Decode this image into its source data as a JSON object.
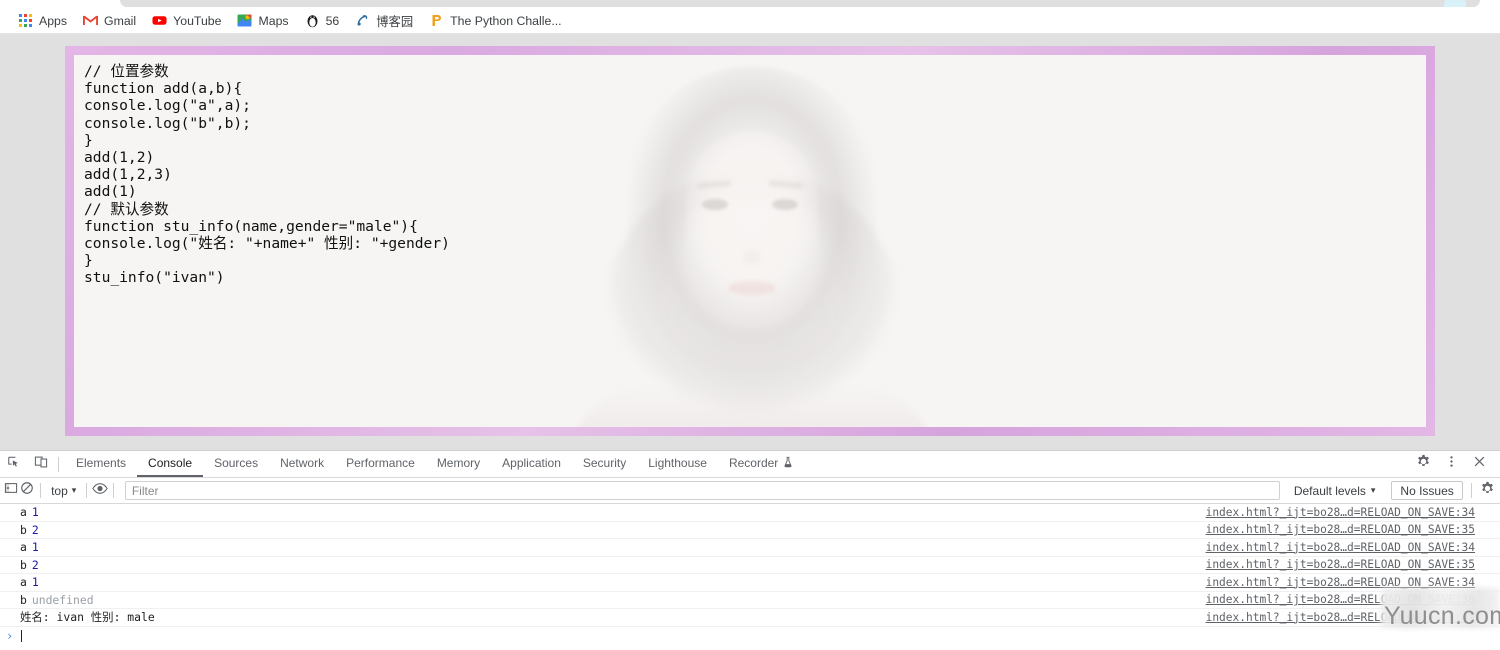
{
  "browser": {
    "bookmarks": [
      {
        "label": "Apps",
        "icon": "apps-grid-icon"
      },
      {
        "label": "Gmail",
        "icon": "gmail-icon"
      },
      {
        "label": "YouTube",
        "icon": "youtube-icon"
      },
      {
        "label": "Maps",
        "icon": "maps-icon"
      },
      {
        "label": "56",
        "icon": "penguin-icon"
      },
      {
        "label": "博客园",
        "icon": "cnblogs-icon"
      },
      {
        "label": "The Python Challe...",
        "icon": "python-challenge-icon"
      }
    ],
    "avatar_icon": "profile-avatar-icon"
  },
  "page": {
    "code": "// 位置参数\nfunction add(a,b){\nconsole.log(\"a\",a);\nconsole.log(\"b\",b);\n}\nadd(1,2)\nadd(1,2,3)\nadd(1)\n// 默认参数\nfunction stu_info(name,gender=\"male\"){\nconsole.log(\"姓名: \"+name+\" 性别: \"+gender)\n}\nstu_info(\"ivan\")",
    "selection_border_color": "#dcaee2",
    "card_background": "#f6f5f4"
  },
  "devtools": {
    "tools": {
      "inspect_icon": "inspect-element-icon",
      "device_toolbar_icon": "device-toolbar-icon",
      "settings_icon": "gear-icon",
      "more_icon": "more-vertical-icon",
      "close_icon": "close-icon"
    },
    "tabs": [
      {
        "label": "Elements",
        "active": false
      },
      {
        "label": "Console",
        "active": true
      },
      {
        "label": "Sources",
        "active": false
      },
      {
        "label": "Network",
        "active": false
      },
      {
        "label": "Performance",
        "active": false
      },
      {
        "label": "Memory",
        "active": false
      },
      {
        "label": "Application",
        "active": false
      },
      {
        "label": "Security",
        "active": false
      },
      {
        "label": "Lighthouse",
        "active": false
      },
      {
        "label": "Recorder",
        "active": false,
        "badge_icon": "experiment-flask-icon"
      }
    ],
    "toolbar": {
      "sidebar_toggle_icon": "console-sidebar-icon",
      "clear_console_icon": "clear-console-icon",
      "context_value": "top",
      "context_caret": "▾",
      "eye_icon": "live-expression-eye-icon",
      "filter_placeholder": "Filter",
      "filter_value": "",
      "level_value": "Default levels",
      "level_caret": "▾",
      "issues_label": "No Issues",
      "console_settings_icon": "gear-icon"
    },
    "console": {
      "accent_number_color": "#1a1aa6",
      "messages": [
        {
          "label": "a",
          "value": "1",
          "value_type": "number",
          "source": "index.html?_ijt=bo28…d=RELOAD_ON_SAVE:34"
        },
        {
          "label": "b",
          "value": "2",
          "value_type": "number",
          "source": "index.html?_ijt=bo28…d=RELOAD_ON_SAVE:35"
        },
        {
          "label": "a",
          "value": "1",
          "value_type": "number",
          "source": "index.html?_ijt=bo28…d=RELOAD_ON_SAVE:34"
        },
        {
          "label": "b",
          "value": "2",
          "value_type": "number",
          "source": "index.html?_ijt=bo28…d=RELOAD_ON_SAVE:35"
        },
        {
          "label": "a",
          "value": "1",
          "value_type": "number",
          "source": "index.html?_ijt=bo28…d=RELOAD_ON_SAVE:34"
        },
        {
          "label": "b",
          "value": "undefined",
          "value_type": "undefined",
          "source": "index.html?_ijt=bo28…d=RELOAD_ON_SAVE:36"
        },
        {
          "label": "姓名: ivan 性别: male",
          "value": "",
          "value_type": "plain",
          "source": "index.html?_ijt=bo28…d=RELOAD_ON_SAVE:41"
        }
      ],
      "prompt_chevron": "›",
      "prompt_value": ""
    }
  },
  "watermark": {
    "text": "Yuucn.com"
  }
}
